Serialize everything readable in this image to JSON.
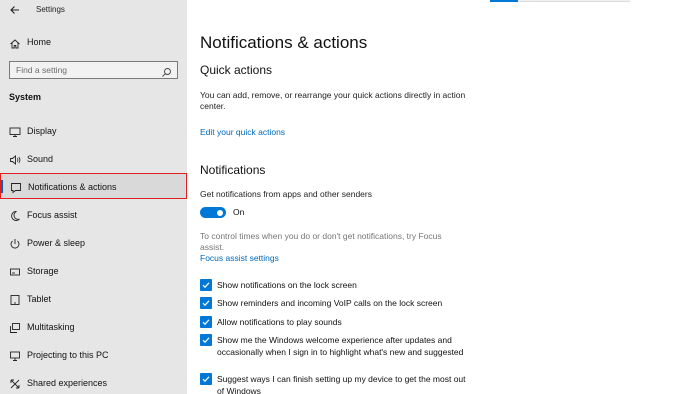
{
  "window": {
    "title": "Settings"
  },
  "sidebar": {
    "home_label": "Home",
    "search_placeholder": "Find a setting",
    "section": "System",
    "items": [
      {
        "label": "Display",
        "icon": "monitor-icon"
      },
      {
        "label": "Sound",
        "icon": "speaker-icon"
      },
      {
        "label": "Notifications & actions",
        "icon": "notification-icon",
        "selected": true
      },
      {
        "label": "Focus assist",
        "icon": "moon-icon"
      },
      {
        "label": "Power & sleep",
        "icon": "power-icon"
      },
      {
        "label": "Storage",
        "icon": "storage-icon"
      },
      {
        "label": "Tablet",
        "icon": "tablet-icon"
      },
      {
        "label": "Multitasking",
        "icon": "multitasking-icon"
      },
      {
        "label": "Projecting to this PC",
        "icon": "projecting-icon"
      },
      {
        "label": "Shared experiences",
        "icon": "shared-experiences-icon"
      }
    ]
  },
  "main": {
    "title": "Notifications & actions",
    "quick_actions": {
      "heading": "Quick actions",
      "description": "You can add, remove, or rearrange your quick actions directly in action center.",
      "link": "Edit your quick actions"
    },
    "notifications": {
      "heading": "Notifications",
      "toggle_label_caption": "Get notifications from apps and other senders",
      "toggle_state": "On",
      "toggle_on": true,
      "focus_hint": "To control times when you do or don't get notifications, try Focus assist.",
      "focus_link": "Focus assist settings",
      "checkboxes": [
        {
          "label": "Show notifications on the lock screen",
          "checked": true
        },
        {
          "label": "Show reminders and incoming VoIP calls on the lock screen",
          "checked": true
        },
        {
          "label": "Allow notifications to play sounds",
          "checked": true
        },
        {
          "label": "Show me the Windows welcome experience after updates and occasionally when I sign in to highlight what's new and suggested",
          "checked": true
        },
        {
          "label": "Suggest ways I can finish setting up my device to get the most out of Windows",
          "checked": true
        }
      ]
    }
  },
  "colors": {
    "accent": "#0078d7",
    "link": "#0067b8",
    "selection_outline": "#e02020",
    "sidebar_bg": "#e6e6e6"
  }
}
